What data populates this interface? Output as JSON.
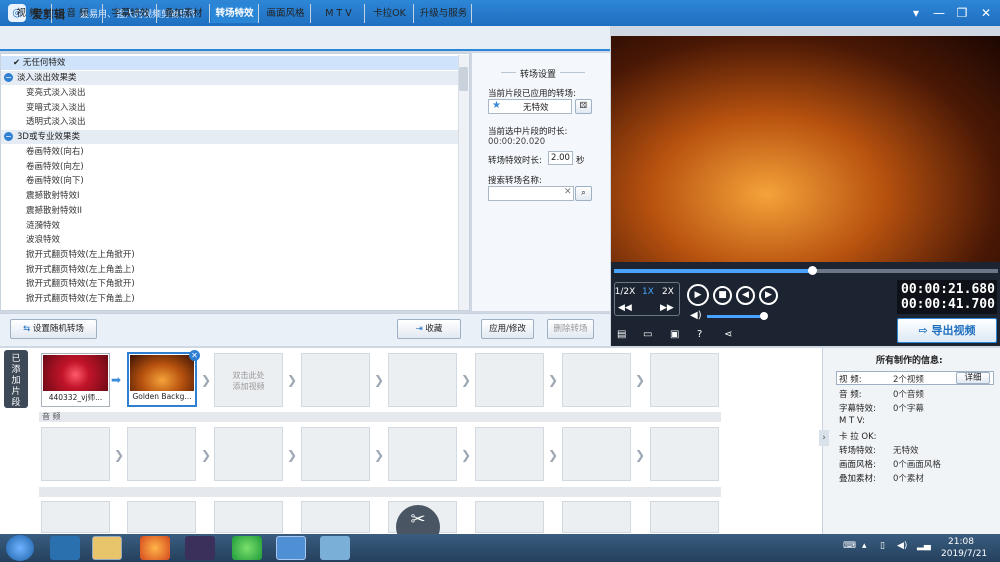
{
  "app": {
    "logo_glyph": "◎",
    "title": "爱剪辑",
    "slogan": "最易用、强大的视频剪辑软件"
  },
  "window_controls": [
    "▾",
    "—",
    "❐",
    "✕"
  ],
  "tabs": [
    "视 频",
    "音 频",
    "字幕特效",
    "叠加素材",
    "转场特效",
    "画面风格",
    "M T V",
    "卡拉OK",
    "升级与服务"
  ],
  "active_tab": "转场特效",
  "effects": {
    "selected": "无任何特效",
    "cat1": "淡入淡出效果类",
    "cat1_items": [
      "变亮式淡入淡出",
      "变暗式淡入淡出",
      "透明式淡入淡出"
    ],
    "cat2": "3D或专业效果类",
    "cat2_items": [
      "卷画特效(向右)",
      "卷画特效(向左)",
      "卷画特效(向下)",
      "震撼散射特效I",
      "震撼散射特效II",
      "涟漪特效",
      "波浪特效",
      "掀开式翻页特效(左上角掀开)",
      "掀开式翻页特效(左上角盖上)",
      "掀开式翻页特效(左下角掀开)",
      "掀开式翻页特效(左下角盖上)"
    ]
  },
  "settings": {
    "title": "转场设置",
    "applied_label": "当前片段已应用的转场:",
    "applied_value": "无特效",
    "duration_label": "当前选中片段的时长:",
    "duration_value": "00:00:20.020",
    "effect_duration_label": "转场特效时长:",
    "effect_duration_value": "2.00",
    "effect_duration_unit": "秒",
    "search_label": "搜索转场名称:",
    "search_value": ""
  },
  "buttons": {
    "random": "设置随机转场",
    "collect": "收藏",
    "apply": "应用/修改",
    "delete": "删除转场"
  },
  "player": {
    "speeds": [
      "1/2X",
      "1X",
      "2X"
    ],
    "time_current": "00:00:21.680",
    "time_total": "00:00:41.700",
    "export": "导出视频",
    "progress": 0.51
  },
  "timeline": {
    "side_tab": "已添加片段",
    "clips": [
      "440332_vj师...",
      "Golden Backg..."
    ],
    "add_hint": "双击此处\n添加视频",
    "audio_label": "音 频"
  },
  "info": {
    "title": "所有制作的信息:",
    "detail_button": "详细",
    "rows": [
      {
        "k": "视    频:",
        "v": "2个视频"
      },
      {
        "k": "音    频:",
        "v": "0个音频"
      },
      {
        "k": "字幕特效:",
        "v": "0个字幕"
      },
      {
        "k": "M  T  V:",
        "v": ""
      },
      {
        "k": "卡  拉  OK:",
        "v": ""
      },
      {
        "k": "转场特效:",
        "v": "无特效"
      },
      {
        "k": "画面风格:",
        "v": "0个画面风格"
      },
      {
        "k": "叠加素材:",
        "v": "0个素材"
      }
    ]
  },
  "taskbar": {
    "time": "21:08",
    "date": "2019/7/21"
  }
}
